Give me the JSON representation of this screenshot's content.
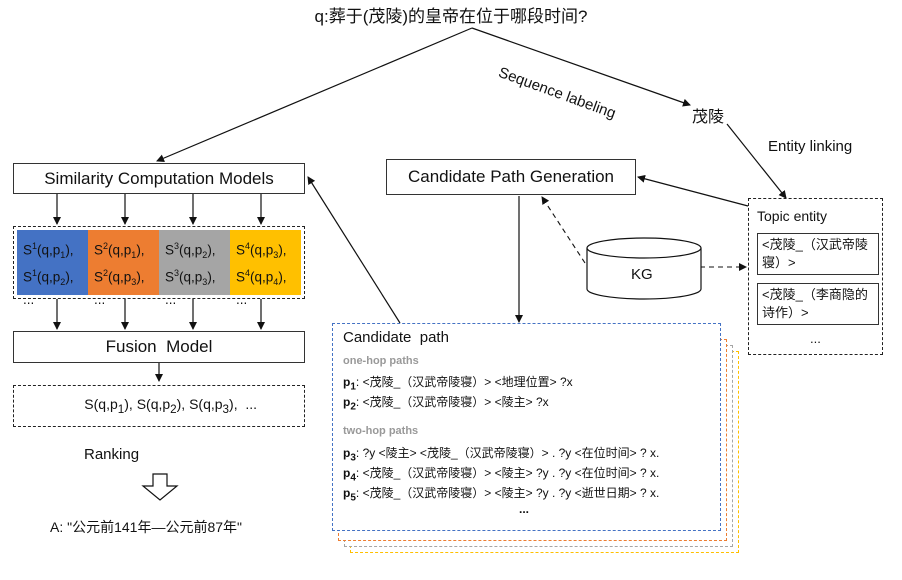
{
  "question": "q:葬于(茂陵)的皇帝在位于哪段时间?",
  "labels": {
    "sequence_labeling": "Sequence labeling",
    "entity_mention": "茂陵",
    "entity_linking": "Entity linking",
    "ranking": "Ranking",
    "kg": "KG",
    "topic_entity_title": "Topic entity",
    "topic_entity_more": "..."
  },
  "boxes": {
    "similarity_models": "Similarity Computation Models",
    "candidate_path_generation": "Candidate Path Generation",
    "fusion_model": "Fusion  Model",
    "candidate_path_title": "Candidate  path"
  },
  "score_columns": [
    {
      "color": "#4472c4",
      "lines": [
        [
          "S",
          "1",
          "(q,p",
          "1",
          "),"
        ],
        [
          "S",
          "1",
          "(q,p",
          "2",
          "),"
        ]
      ],
      "more": "..."
    },
    {
      "color": "#ed7d31",
      "lines": [
        [
          "S",
          "2",
          "(q,p",
          "1",
          "),"
        ],
        [
          "S",
          "2",
          "(q,p",
          "3",
          "),"
        ]
      ],
      "more": "..."
    },
    {
      "color": "#a5a5a5",
      "lines": [
        [
          "S",
          "3",
          "(q,p",
          "2",
          "),"
        ],
        [
          "S",
          "3",
          "(q,p",
          "3",
          "),"
        ]
      ],
      "more": "..."
    },
    {
      "color": "#ffc000",
      "lines": [
        [
          "S",
          "4",
          "(q,p",
          "3",
          "),"
        ],
        [
          "S",
          "4",
          "(q,p",
          "4",
          "),"
        ]
      ],
      "more": "..."
    }
  ],
  "fused_scores": "S(q,p1), S(q,p2), S(q,p3),  ...",
  "answer": "A: \"公元前141年—公元前87年\"",
  "topic_entities": [
    "<茂陵_（汉武帝陵寝）>",
    "<茂陵_（李商隐的诗作）>"
  ],
  "candidate_paths": {
    "one_hop_label": "one-hop paths",
    "two_hop_label": "two-hop paths",
    "one_hop": [
      {
        "id": "p1",
        "text": ": <茂陵_（汉武帝陵寝）> <地理位置> ?x"
      },
      {
        "id": "p2",
        "text": ": <茂陵_（汉武帝陵寝）> <陵主> ?x"
      }
    ],
    "two_hop": [
      {
        "id": "p3",
        "text": ": ?y <陵主> <茂陵_（汉武帝陵寝）> . ?y <在位时间> ? x."
      },
      {
        "id": "p4",
        "text": ": <茂陵_（汉武帝陵寝）> <陵主> ?y . ?y <在位时间> ? x."
      },
      {
        "id": "p5",
        "text": ": <茂陵_（汉武帝陵寝）> <陵主> ?y . ?y <逝世日期> ? x."
      }
    ],
    "more": "..."
  },
  "colors": {
    "blue_dash": "#4472c4",
    "orange_dash": "#ed7d31",
    "yellow_dash": "#ffc000",
    "grey_dash": "#a5a5a5"
  }
}
